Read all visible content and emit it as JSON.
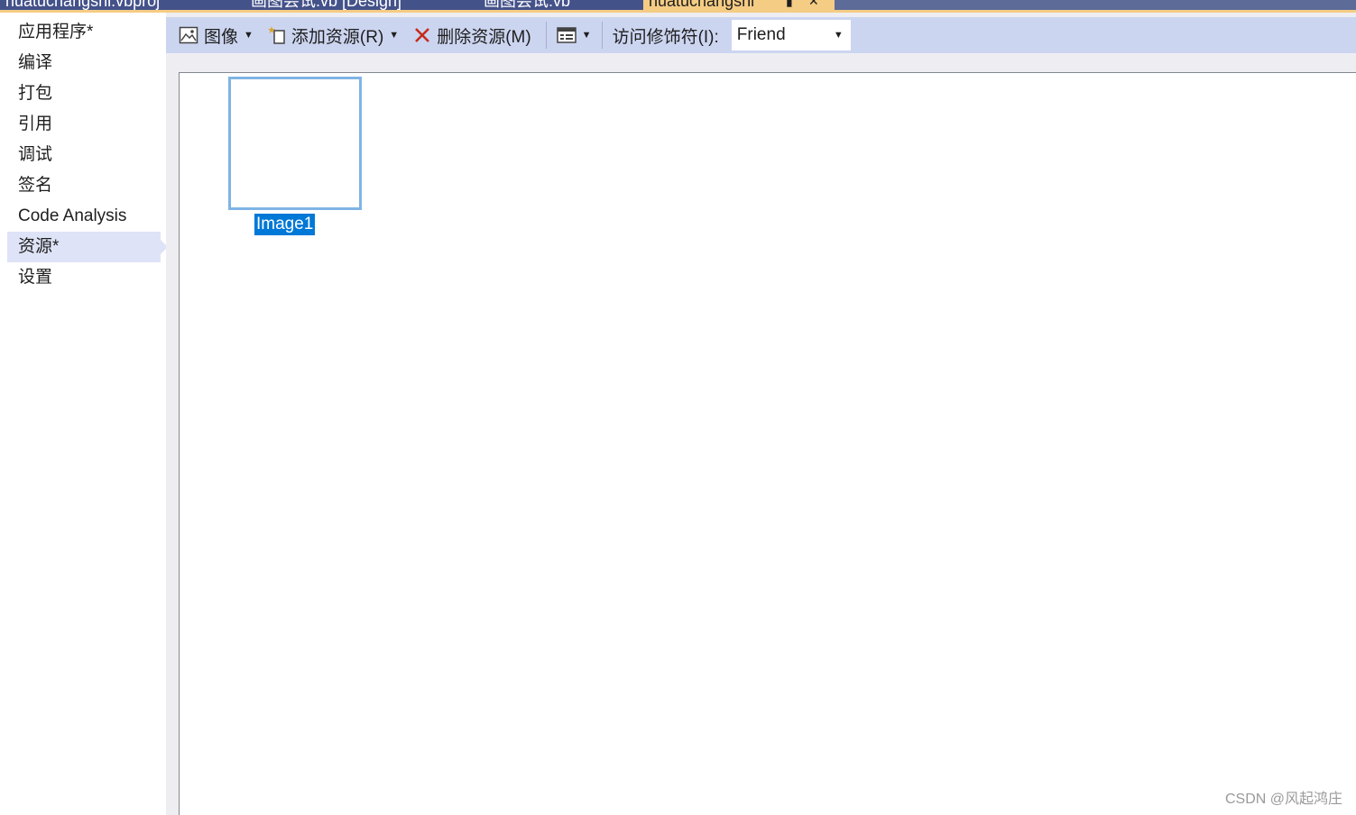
{
  "tabs": [
    {
      "label": "huatuchangshi.vbproj",
      "active": false
    },
    {
      "label": "画图尝试.vb [Design]",
      "active": false
    },
    {
      "label": "画图尝试.vb",
      "active": false
    },
    {
      "label": "huatuchangshi",
      "active": true
    }
  ],
  "sidebar": {
    "items": [
      {
        "label": "应用程序*"
      },
      {
        "label": "编译"
      },
      {
        "label": "打包"
      },
      {
        "label": "引用"
      },
      {
        "label": "调试"
      },
      {
        "label": "签名"
      },
      {
        "label": "Code Analysis"
      },
      {
        "label": "资源*",
        "selected": true
      },
      {
        "label": "设置"
      }
    ]
  },
  "toolbar": {
    "images_label": "图像",
    "add_resource_label": "添加资源(R)",
    "remove_resource_label": "删除资源(M)",
    "access_modifier_label": "访问修饰符(I):",
    "access_modifier_value": "Friend"
  },
  "resources": [
    {
      "name": "Image1"
    }
  ],
  "watermark": "CSDN @风起鸿庄",
  "colors": {
    "toolbar_bg": "#ccd5f0",
    "selected_nav_bg": "#dfe3f7",
    "selection_blue": "#0078d7",
    "active_tab": "#f5cc84",
    "remove_icon": "#c42b1c"
  }
}
